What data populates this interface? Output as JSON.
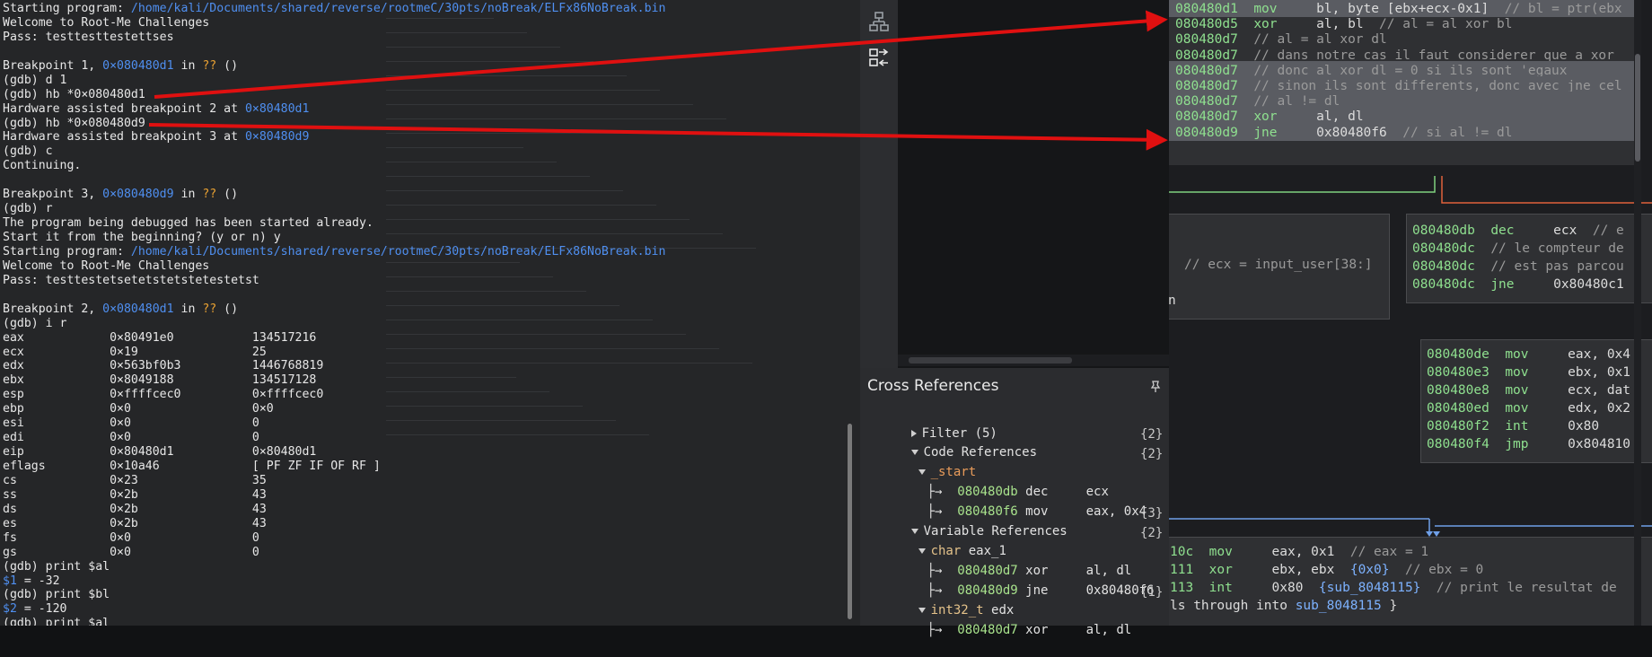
{
  "terminal": {
    "lines": [
      [
        {
          "t": "Starting program: "
        },
        {
          "t": "/home/kali/Documents/shared/reverse/rootmeC/30pts/noBreak/ELFx86NoBreak.bin",
          "c": "b"
        }
      ],
      [
        {
          "t": "Welcome to Root-Me Challenges"
        }
      ],
      [
        {
          "t": "Pass: testtesttestettses"
        }
      ],
      [
        {
          "t": ""
        }
      ],
      [
        {
          "t": "Breakpoint 1, "
        },
        {
          "t": "0×080480d1",
          "c": "b"
        },
        {
          "t": " in "
        },
        {
          "t": "??",
          "c": "o"
        },
        {
          "t": " ()"
        }
      ],
      [
        {
          "t": "(gdb) d 1"
        }
      ],
      [
        {
          "t": "(gdb) hb *0×080480d1"
        }
      ],
      [
        {
          "t": "Hardware assisted breakpoint 2 at "
        },
        {
          "t": "0×80480d1",
          "c": "b"
        }
      ],
      [
        {
          "t": "(gdb) hb *0×080480d9"
        }
      ],
      [
        {
          "t": "Hardware assisted breakpoint 3 at "
        },
        {
          "t": "0×80480d9",
          "c": "b"
        }
      ],
      [
        {
          "t": "(gdb) c"
        }
      ],
      [
        {
          "t": "Continuing."
        }
      ],
      [
        {
          "t": ""
        }
      ],
      [
        {
          "t": "Breakpoint 3, "
        },
        {
          "t": "0×080480d9",
          "c": "b"
        },
        {
          "t": " in "
        },
        {
          "t": "??",
          "c": "o"
        },
        {
          "t": " ()"
        }
      ],
      [
        {
          "t": "(gdb) r"
        }
      ],
      [
        {
          "t": "The program being debugged has been started already."
        }
      ],
      [
        {
          "t": "Start it from the beginning? (y or n) y"
        }
      ],
      [
        {
          "t": "Starting program: "
        },
        {
          "t": "/home/kali/Documents/shared/reverse/rootmeC/30pts/noBreak/ELFx86NoBreak.bin",
          "c": "b"
        }
      ],
      [
        {
          "t": "Welcome to Root-Me Challenges"
        }
      ],
      [
        {
          "t": "Pass: testtestetsetetstetstetestetst"
        }
      ],
      [
        {
          "t": ""
        }
      ],
      [
        {
          "t": "Breakpoint 2, "
        },
        {
          "t": "0×080480d1",
          "c": "b"
        },
        {
          "t": " in "
        },
        {
          "t": "??",
          "c": "o"
        },
        {
          "t": " ()"
        }
      ],
      [
        {
          "t": "(gdb) i r"
        }
      ],
      [
        {
          "t": "eax            0×80491e0           134517216"
        }
      ],
      [
        {
          "t": "ecx            0×19                25"
        }
      ],
      [
        {
          "t": "edx            0×563bf0b3          1446768819"
        }
      ],
      [
        {
          "t": "ebx            0×8049188           134517128"
        }
      ],
      [
        {
          "t": "esp            0×ffffcec0          0×ffffcec0"
        }
      ],
      [
        {
          "t": "ebp            0×0                 0×0"
        }
      ],
      [
        {
          "t": "esi            0×0                 0"
        }
      ],
      [
        {
          "t": "edi            0×0                 0"
        }
      ],
      [
        {
          "t": "eip            0×80480d1           0×80480d1"
        }
      ],
      [
        {
          "t": "eflags         0×10a46             [ PF ZF IF OF RF ]"
        }
      ],
      [
        {
          "t": "cs             0×23                35"
        }
      ],
      [
        {
          "t": "ss             0×2b                43"
        }
      ],
      [
        {
          "t": "ds             0×2b                43"
        }
      ],
      [
        {
          "t": "es             0×2b                43"
        }
      ],
      [
        {
          "t": "fs             0×0                 0"
        }
      ],
      [
        {
          "t": "gs             0×0                 0"
        }
      ],
      [
        {
          "t": "(gdb) print $al"
        }
      ],
      [
        {
          "t": "$1",
          "c": "b"
        },
        {
          "t": " = -32"
        }
      ],
      [
        {
          "t": "(gdb) print $bl"
        }
      ],
      [
        {
          "t": "$2",
          "c": "b"
        },
        {
          "t": " = -120"
        }
      ],
      [
        {
          "t": "(gdb) print $al"
        }
      ]
    ]
  },
  "cross_references": {
    "title": "Cross References",
    "filter": "Filter (5)",
    "code_refs": {
      "label": "Code References",
      "count": "{2}"
    },
    "start_group": {
      "label": "_start",
      "count": "{2}"
    },
    "start_items": [
      {
        "arrow": "├→",
        "addr": "080480db",
        "instr": "dec",
        "ops": "ecx"
      },
      {
        "arrow": "├→",
        "addr": "080480f6",
        "instr": "mov",
        "ops": "eax, 0x4"
      }
    ],
    "var_refs": {
      "label": "Variable References",
      "count": "{3}"
    },
    "eax_group": {
      "type": "char",
      "name": "eax_1",
      "count": "{2}"
    },
    "eax_items": [
      {
        "arrow": "├→",
        "addr": "080480d7",
        "instr": "xor",
        "ops": "al, dl"
      },
      {
        "arrow": "├→",
        "addr": "080480d9",
        "instr": "jne",
        "ops": "0x80480f6"
      }
    ],
    "edx_group": {
      "type": "int32_t",
      "name": "edx",
      "count": "{1}"
    },
    "edx_items": [
      {
        "arrow": "├→",
        "addr": "080480d7",
        "instr": "xor",
        "ops": "al, dl"
      }
    ]
  },
  "graph": {
    "top_block": [
      {
        "addr": "080480d1",
        "mn": "mov",
        "ops": "bl, byte [ebx+ecx-0x1]",
        "cm": "// bl = ptr(ebx",
        "hl": true
      },
      {
        "addr": "080480d5",
        "mn": "xor",
        "ops": "al, bl",
        "cm": "// al = al xor bl",
        "hl": false
      },
      {
        "addr": "080480d7",
        "mn": "",
        "ops": "",
        "cm": "// al = al xor dl",
        "hl": false
      },
      {
        "addr": "080480d7",
        "mn": "",
        "ops": "",
        "cm": "// dans notre cas il faut considerer que a xor",
        "hl": false
      },
      {
        "addr": "080480d7",
        "mn": "",
        "ops": "",
        "cm": "// donc al xor dl = 0 si ils sont 'egaux",
        "hl": true
      },
      {
        "addr": "080480d7",
        "mn": "",
        "ops": "",
        "cm": "// sinon ils sont differents, donc avec jne cel",
        "hl": true
      },
      {
        "addr": "080480d7",
        "mn": "",
        "ops": "",
        "cm": "// al != dl",
        "hl": true
      },
      {
        "addr": "080480d7",
        "mn": "xor",
        "ops": "al, dl",
        "cm": "",
        "hl": true
      },
      {
        "addr": "080480d9",
        "mn": "jne",
        "ops": "0x80480f6",
        "cm": "// si al != dl",
        "hl": true
      }
    ],
    "left_block": {
      "comment": "// ecx = input_user[38:]",
      "tail": "n"
    },
    "mid_block": [
      {
        "addr": "080480db",
        "mn": "dec",
        "ops": "ecx",
        "cm": "// e"
      },
      {
        "addr": "080480dc",
        "mn": "",
        "ops": "",
        "cm": "// le compteur de"
      },
      {
        "addr": "080480dc",
        "mn": "",
        "ops": "",
        "cm": "// est pas parcou"
      },
      {
        "addr": "080480dc",
        "mn": "jne",
        "ops": "0x80480c1",
        "cm": ""
      }
    ],
    "right_block": [
      {
        "addr": "080480de",
        "mn": "mov",
        "ops": "eax, 0x4"
      },
      {
        "addr": "080480e3",
        "mn": "mov",
        "ops": "ebx, 0x1"
      },
      {
        "addr": "080480e8",
        "mn": "mov",
        "ops": "ecx, dat"
      },
      {
        "addr": "080480ed",
        "mn": "mov",
        "ops": "edx, 0x2"
      },
      {
        "addr": "080480f2",
        "mn": "int",
        "ops": "0x80"
      },
      {
        "addr": "080480f4",
        "mn": "jmp",
        "ops": "0x804810"
      }
    ],
    "bottom_block": [
      {
        "addr": "10c",
        "mn": "mov",
        "ops": "eax, 0x1",
        "cm": "// eax = 1"
      },
      {
        "addr": "111",
        "mn": "xor",
        "ops": "ebx, ebx",
        "extra": "{0x0}",
        "cm": "// ebx = 0"
      },
      {
        "addr": "113",
        "mn": "int",
        "ops": "0x80",
        "extra": "{sub_8048115}",
        "cm": "// print le resultat de"
      }
    ],
    "bottom_tail": {
      "text": "ls through into ",
      "label": "sub_8048115",
      "end": " }"
    }
  }
}
